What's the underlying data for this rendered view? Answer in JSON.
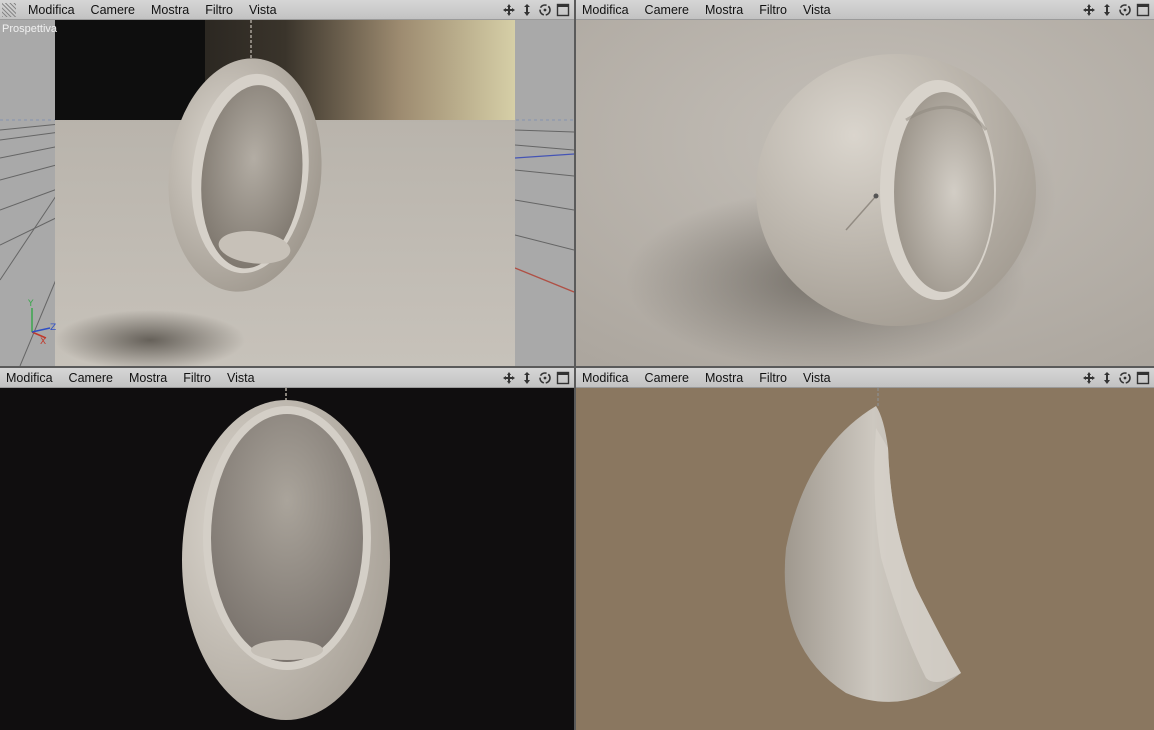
{
  "menu_labels": [
    "Modifica",
    "Camere",
    "Mostra",
    "Filtro",
    "Vista"
  ],
  "viewports": [
    {
      "id": "top-left",
      "label": "Prospettiva",
      "background": "#a9a9a9"
    },
    {
      "id": "top-right",
      "background": "#b8b3ac"
    },
    {
      "id": "bottom-left",
      "background": "#100e0f"
    },
    {
      "id": "bottom-right",
      "background": "#8a7760"
    }
  ],
  "tool_icons": [
    "move-icon",
    "zoom-icon",
    "rotate-icon",
    "maximize-icon"
  ],
  "axis_labels": {
    "y": "Y",
    "x": "X",
    "z": "Z"
  },
  "colors": {
    "menubar": "#c8c8c8",
    "chair": "#c9c4bc",
    "axis_x": "#c0392b",
    "axis_y": "#3aa64c",
    "axis_z": "#2f4fc4"
  }
}
